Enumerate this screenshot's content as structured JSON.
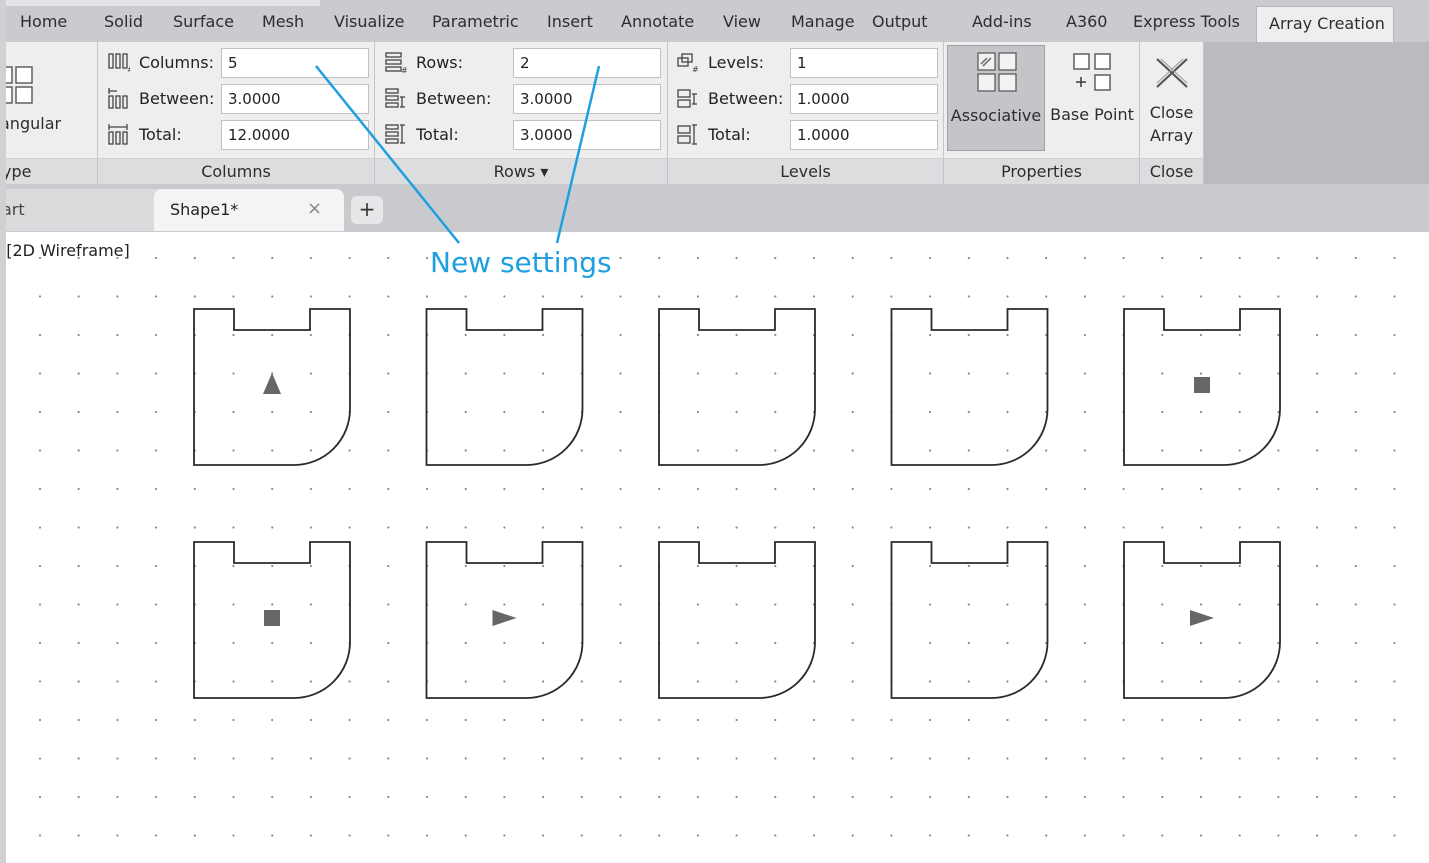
{
  "ribbon_tabs": [
    "Home",
    "Solid",
    "Surface",
    "Mesh",
    "Visualize",
    "Parametric",
    "Insert",
    "Annotate",
    "View",
    "Manage",
    "Output",
    "Add-ins",
    "A360",
    "Express Tools",
    "Array Creation"
  ],
  "active_tab": "Array Creation",
  "type_panel": {
    "button_label": "angular",
    "label": "ype"
  },
  "columns_panel": {
    "columns_label": "Columns:",
    "columns_value": "5",
    "between_label": "Between:",
    "between_value": "3.0000",
    "total_label": "Total:",
    "total_value": "12.0000",
    "label": "Columns"
  },
  "rows_panel": {
    "rows_label": "Rows:",
    "rows_value": "2",
    "between_label": "Between:",
    "between_value": "3.0000",
    "total_label": "Total:",
    "total_value": "3.0000",
    "label": "Rows ▾"
  },
  "levels_panel": {
    "levels_label": "Levels:",
    "levels_value": "1",
    "between_label": "Between:",
    "between_value": "1.0000",
    "total_label": "Total:",
    "total_value": "1.0000",
    "label": "Levels"
  },
  "properties_panel": {
    "associative_label": "Associative",
    "basepoint_label": "Base Point",
    "label": "Properties"
  },
  "close_panel": {
    "close_line1": "Close",
    "close_line2": "Array",
    "label": "Close"
  },
  "doc_tabs": {
    "start_label": "art",
    "active_label": "Shape1*",
    "close_glyph": "×",
    "new_glyph": "+"
  },
  "viewport_label": "][2D Wireframe]",
  "annotation": "New settings",
  "colors": {
    "accent": "#1e9fe0",
    "ribbon": "#eeeeef",
    "tabbar": "#c9cbce",
    "active_button": "#c3c5c8"
  }
}
